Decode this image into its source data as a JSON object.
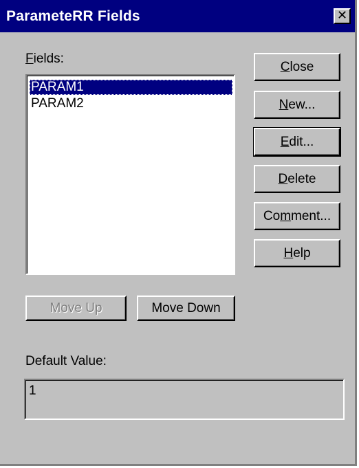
{
  "window": {
    "title": "ParameteRR Fields",
    "close_glyph": "✕"
  },
  "fields": {
    "label_mnemonic": "F",
    "label_rest": "ields:",
    "items": [
      "PARAM1",
      "PARAM2"
    ],
    "selected_index": 0
  },
  "buttons": {
    "close": {
      "mn": "C",
      "rest": "lose"
    },
    "new": {
      "mn": "N",
      "rest": "ew..."
    },
    "edit": {
      "mn": "E",
      "rest": "dit..."
    },
    "delete": {
      "mn": "D",
      "rest": "elete"
    },
    "comment": {
      "pre": "Co",
      "mn": "m",
      "rest": "ment..."
    },
    "help": {
      "mn": "H",
      "rest": "elp"
    },
    "move_up": "Move Up",
    "move_down": "Move Down"
  },
  "default_value": {
    "label": "Default Value:",
    "value": "1"
  },
  "colors": {
    "face": "#c0c0c0",
    "titlebar": "#000080",
    "selection": "#000080"
  }
}
